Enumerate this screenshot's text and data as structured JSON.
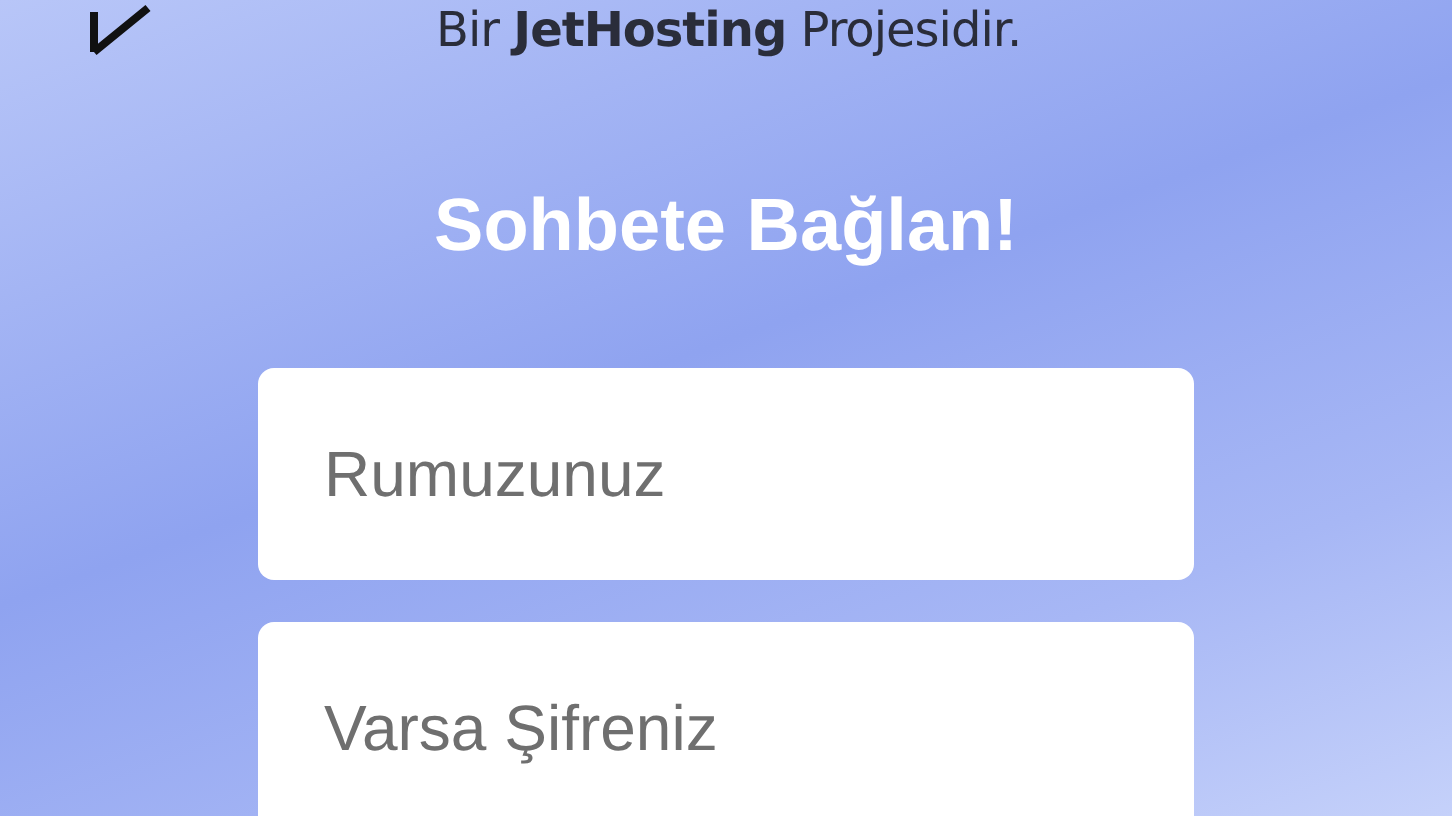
{
  "header": {
    "tagline": "Bir **JetHosting** Projesidir."
  },
  "title": "Sohbete Bağlan!",
  "fields": [
    {
      "placeholder": "Rumuzunuz"
    },
    {
      "placeholder": "Varsa Şifreniz"
    }
  ]
}
